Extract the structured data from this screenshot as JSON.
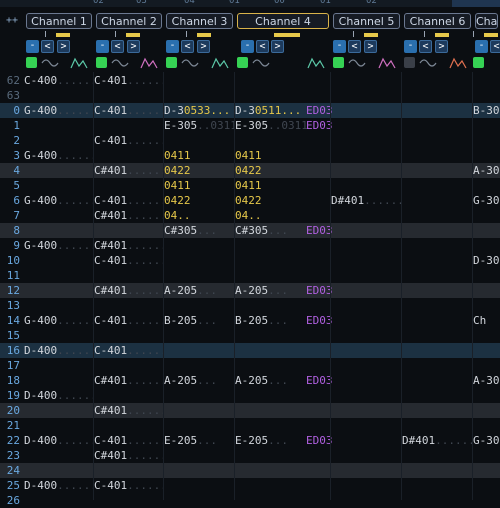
{
  "top_strip": [
    "02",
    "03",
    "04",
    "01",
    "00",
    "01",
    "02"
  ],
  "corner_label": "++",
  "channels": [
    {
      "name": "Channel 1",
      "selected": false,
      "enabled": true
    },
    {
      "name": "Channel 2",
      "selected": false,
      "enabled": true
    },
    {
      "name": "Channel 3",
      "selected": false,
      "enabled": true
    },
    {
      "name": "Channel 4",
      "selected": true,
      "enabled": true
    },
    {
      "name": "Channel 5",
      "selected": false,
      "enabled": true
    },
    {
      "name": "Channel 6",
      "selected": false,
      "enabled": false
    },
    {
      "name": "Cha",
      "selected": false,
      "enabled": true
    }
  ],
  "buttons": {
    "minus": "-",
    "left": "<",
    "right": ">"
  },
  "rows": [
    {
      "num": "62",
      "pre": true,
      "cells": [
        [
          "C-400",
          ".........."
        ],
        [
          "C-401",
          ".........."
        ],
        [
          "",
          ""
        ],
        [
          "",
          ""
        ],
        [
          "",
          ""
        ],
        [
          "",
          ""
        ],
        [
          "",
          ""
        ]
      ]
    },
    {
      "num": "63",
      "pre": true,
      "cells": [
        [
          "",
          ""
        ],
        [
          "",
          ""
        ],
        [
          "",
          ""
        ],
        [
          "",
          ""
        ],
        [
          "",
          ""
        ],
        [
          "",
          ""
        ],
        [
          "",
          ""
        ]
      ]
    },
    {
      "num": "0",
      "cur": true,
      "cells": [
        [
          "G-400",
          ".........."
        ],
        [
          "C-401",
          ".........."
        ],
        [
          "D-3",
          "0533..."
        ],
        [
          "D-3",
          "0511..."
        ],
        [
          "ED03",
          ""
        ],
        [
          "",
          ""
        ],
        [
          "B-30",
          ""
        ]
      ]
    },
    {
      "num": "1",
      "cells": [
        [
          "",
          ""
        ],
        [
          "",
          ""
        ],
        [
          "E-305",
          "..0311"
        ],
        [
          "E-305",
          "..0311"
        ],
        [
          "ED03",
          ""
        ],
        [
          "",
          ""
        ],
        [
          "",
          ""
        ]
      ]
    },
    {
      "num": "2",
      "cells": [
        [
          "",
          ""
        ],
        [
          "C-401",
          ".........."
        ],
        [
          "",
          ""
        ],
        [
          "",
          ""
        ],
        [
          "",
          ""
        ],
        [
          "",
          ""
        ],
        [
          "",
          ""
        ]
      ]
    },
    {
      "num": "3",
      "cells": [
        [
          "G-400",
          ".........."
        ],
        [
          "",
          ""
        ],
        [
          "",
          "0411"
        ],
        [
          "",
          "0411"
        ],
        [
          "",
          ""
        ],
        [
          "",
          ""
        ],
        [
          "",
          ""
        ]
      ]
    },
    {
      "num": "4",
      "beat": true,
      "cells": [
        [
          "",
          ""
        ],
        [
          "C#401",
          ".........."
        ],
        [
          "",
          "0422"
        ],
        [
          "",
          "0422"
        ],
        [
          "",
          ""
        ],
        [
          "",
          ""
        ],
        [
          "A-30",
          ""
        ]
      ]
    },
    {
      "num": "5",
      "cells": [
        [
          "",
          ""
        ],
        [
          "",
          ""
        ],
        [
          "",
          "0411"
        ],
        [
          "",
          "0411"
        ],
        [
          "",
          ""
        ],
        [
          "",
          ""
        ],
        [
          "",
          ""
        ]
      ]
    },
    {
      "num": "6",
      "cells": [
        [
          "G-400",
          ".........."
        ],
        [
          "C-401",
          ".........."
        ],
        [
          "",
          "0422"
        ],
        [
          "",
          "0422"
        ],
        [
          "D#401",
          ".........."
        ],
        [
          "",
          ""
        ],
        [
          "G-30",
          ""
        ]
      ]
    },
    {
      "num": "7",
      "cells": [
        [
          "",
          ""
        ],
        [
          "C#401",
          ".........."
        ],
        [
          "",
          "04.."
        ],
        [
          "",
          "04.."
        ],
        [
          "",
          ""
        ],
        [
          "",
          ""
        ],
        [
          "",
          ""
        ]
      ]
    },
    {
      "num": "8",
      "beat": true,
      "cells": [
        [
          "",
          ""
        ],
        [
          "",
          ""
        ],
        [
          "C#305",
          "..."
        ],
        [
          "C#305",
          "..."
        ],
        [
          "ED03",
          ""
        ],
        [
          "",
          ""
        ],
        [
          "",
          ""
        ]
      ]
    },
    {
      "num": "9",
      "cells": [
        [
          "G-400",
          ".........."
        ],
        [
          "C#401",
          ".........."
        ],
        [
          "",
          ""
        ],
        [
          "",
          ""
        ],
        [
          "",
          ""
        ],
        [
          "",
          ""
        ],
        [
          "",
          ""
        ]
      ]
    },
    {
      "num": "10",
      "cells": [
        [
          "",
          ""
        ],
        [
          "C-401",
          ".........."
        ],
        [
          "",
          ""
        ],
        [
          "",
          ""
        ],
        [
          "",
          ""
        ],
        [
          "",
          ""
        ],
        [
          "D-30",
          ""
        ]
      ]
    },
    {
      "num": "11",
      "cells": [
        [
          "",
          ""
        ],
        [
          "",
          ""
        ],
        [
          "",
          ""
        ],
        [
          "",
          ""
        ],
        [
          "",
          ""
        ],
        [
          "",
          ""
        ],
        [
          "",
          ""
        ]
      ]
    },
    {
      "num": "12",
      "beat": true,
      "cells": [
        [
          "",
          ""
        ],
        [
          "C#401",
          ".........."
        ],
        [
          "A-205",
          "..."
        ],
        [
          "A-205",
          "..."
        ],
        [
          "ED03",
          ""
        ],
        [
          "",
          ""
        ],
        [
          "",
          ""
        ]
      ]
    },
    {
      "num": "13",
      "cells": [
        [
          "",
          ""
        ],
        [
          "",
          ""
        ],
        [
          "",
          ""
        ],
        [
          "",
          ""
        ],
        [
          "",
          ""
        ],
        [
          "",
          ""
        ],
        [
          "",
          ""
        ]
      ]
    },
    {
      "num": "14",
      "cells": [
        [
          "G-400",
          ".........."
        ],
        [
          "C-401",
          ".........."
        ],
        [
          "B-205",
          "..."
        ],
        [
          "B-205",
          "..."
        ],
        [
          "ED03",
          ""
        ],
        [
          "",
          ""
        ],
        [
          "Ch",
          ""
        ]
      ]
    },
    {
      "num": "15",
      "cells": [
        [
          "",
          ""
        ],
        [
          "",
          ""
        ],
        [
          "",
          ""
        ],
        [
          "",
          ""
        ],
        [
          "",
          ""
        ],
        [
          "",
          ""
        ],
        [
          "",
          ""
        ]
      ]
    },
    {
      "num": "16",
      "cur": true,
      "cells": [
        [
          "D-400",
          ".........."
        ],
        [
          "C-401",
          ".........."
        ],
        [
          "",
          ""
        ],
        [
          "",
          ""
        ],
        [
          "",
          ""
        ],
        [
          "",
          ""
        ],
        [
          "",
          ""
        ]
      ]
    },
    {
      "num": "17",
      "cells": [
        [
          "",
          ""
        ],
        [
          "",
          ""
        ],
        [
          "",
          ""
        ],
        [
          "",
          ""
        ],
        [
          "",
          ""
        ],
        [
          "",
          ""
        ],
        [
          "",
          ""
        ]
      ]
    },
    {
      "num": "18",
      "cells": [
        [
          "",
          ""
        ],
        [
          "C#401",
          ".........."
        ],
        [
          "A-205",
          "..."
        ],
        [
          "A-205",
          "..."
        ],
        [
          "ED03",
          ""
        ],
        [
          "",
          ""
        ],
        [
          "A-30",
          ""
        ]
      ]
    },
    {
      "num": "19",
      "cells": [
        [
          "D-400",
          ".........."
        ],
        [
          "",
          ""
        ],
        [
          "",
          ""
        ],
        [
          "",
          ""
        ],
        [
          "",
          ""
        ],
        [
          "",
          ""
        ],
        [
          "",
          ""
        ]
      ]
    },
    {
      "num": "20",
      "beat": true,
      "cells": [
        [
          "",
          ""
        ],
        [
          "C#401",
          ".........."
        ],
        [
          "",
          ""
        ],
        [
          "",
          ""
        ],
        [
          "",
          ""
        ],
        [
          "",
          ""
        ],
        [
          "",
          ""
        ]
      ]
    },
    {
      "num": "21",
      "cells": [
        [
          "",
          ""
        ],
        [
          "",
          ""
        ],
        [
          "",
          ""
        ],
        [
          "",
          ""
        ],
        [
          "",
          ""
        ],
        [
          "",
          ""
        ],
        [
          "",
          ""
        ]
      ]
    },
    {
      "num": "22",
      "cells": [
        [
          "D-400",
          ".........."
        ],
        [
          "C-401",
          ".........."
        ],
        [
          "E-205",
          "..."
        ],
        [
          "E-205",
          "..."
        ],
        [
          "ED03",
          ""
        ],
        [
          "D#401",
          ".........."
        ],
        [
          "G-30",
          ""
        ]
      ]
    },
    {
      "num": "23",
      "cells": [
        [
          "",
          ""
        ],
        [
          "C#401",
          ".........."
        ],
        [
          "",
          ""
        ],
        [
          "",
          ""
        ],
        [
          "",
          ""
        ],
        [
          "",
          ""
        ],
        [
          "",
          ""
        ]
      ]
    },
    {
      "num": "24",
      "beat": true,
      "cells": [
        [
          "",
          ""
        ],
        [
          "",
          ""
        ],
        [
          "",
          ""
        ],
        [
          "",
          ""
        ],
        [
          "",
          ""
        ],
        [
          "",
          ""
        ],
        [
          "",
          ""
        ]
      ]
    },
    {
      "num": "25",
      "cells": [
        [
          "D-400",
          ".........."
        ],
        [
          "C-401",
          ".........."
        ],
        [
          "",
          ""
        ],
        [
          "",
          ""
        ],
        [
          "",
          ""
        ],
        [
          "",
          ""
        ],
        [
          "",
          ""
        ]
      ]
    },
    {
      "num": "26",
      "cells": [
        [
          "",
          ""
        ],
        [
          "",
          ""
        ],
        [
          "",
          ""
        ],
        [
          "",
          ""
        ],
        [
          "",
          ""
        ],
        [
          "",
          ""
        ],
        [
          "",
          ""
        ]
      ]
    }
  ]
}
